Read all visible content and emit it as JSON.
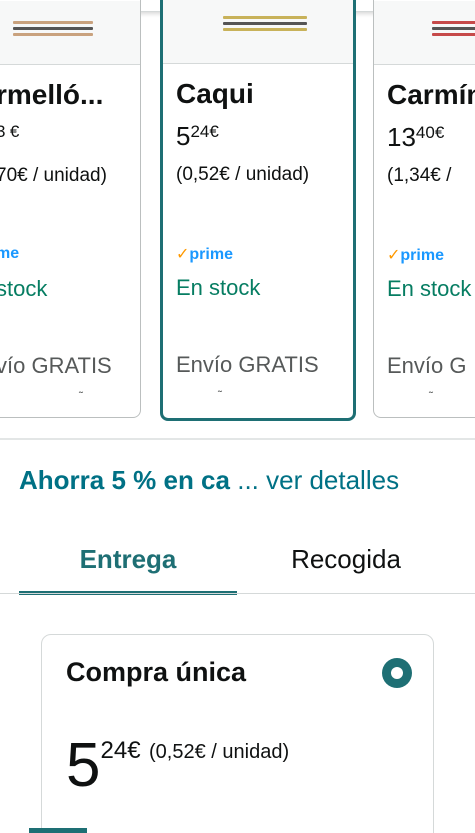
{
  "variations": [
    {
      "name": "rmelló...",
      "price_whole": "",
      "price_fraction": "3",
      "currency": "€",
      "unit_price": "70€ / unidad)",
      "prime": "me",
      "stock": "stock",
      "shipping": "vío GRATIS",
      "tilde": "˜",
      "pen_color": "#c9a27e"
    },
    {
      "name": "Caqui",
      "price_whole": "5",
      "price_fraction": "24",
      "currency": "€",
      "unit_price": "(0,52€ / unidad)",
      "prime": "prime",
      "stock": "En stock",
      "shipping": "Envío GRATIS",
      "tilde": "˜",
      "pen_color": "#c8b25a",
      "selected": true
    },
    {
      "name": "Carmín",
      "price_whole": "13",
      "price_fraction": "40",
      "currency": "€",
      "unit_price": "(1,34€ /",
      "prime": "prime",
      "stock": "En stock",
      "shipping": "Envío G",
      "tilde": "˜",
      "pen_color": "#c64a4a"
    }
  ],
  "coupon": {
    "bold": "Ahorra 5 % en ca",
    "link": "... ver detalles"
  },
  "tabs": [
    "Entrega",
    "Recogida"
  ],
  "buy_box": {
    "title": "Compra única",
    "price_whole": "5",
    "price_fraction": "24",
    "currency": "€",
    "unit_price": "(0,52€ / unidad)"
  },
  "colors": {
    "accent": "#1e6f74",
    "link": "#007185",
    "stock": "#067d62",
    "prime": "#1a98ff"
  }
}
